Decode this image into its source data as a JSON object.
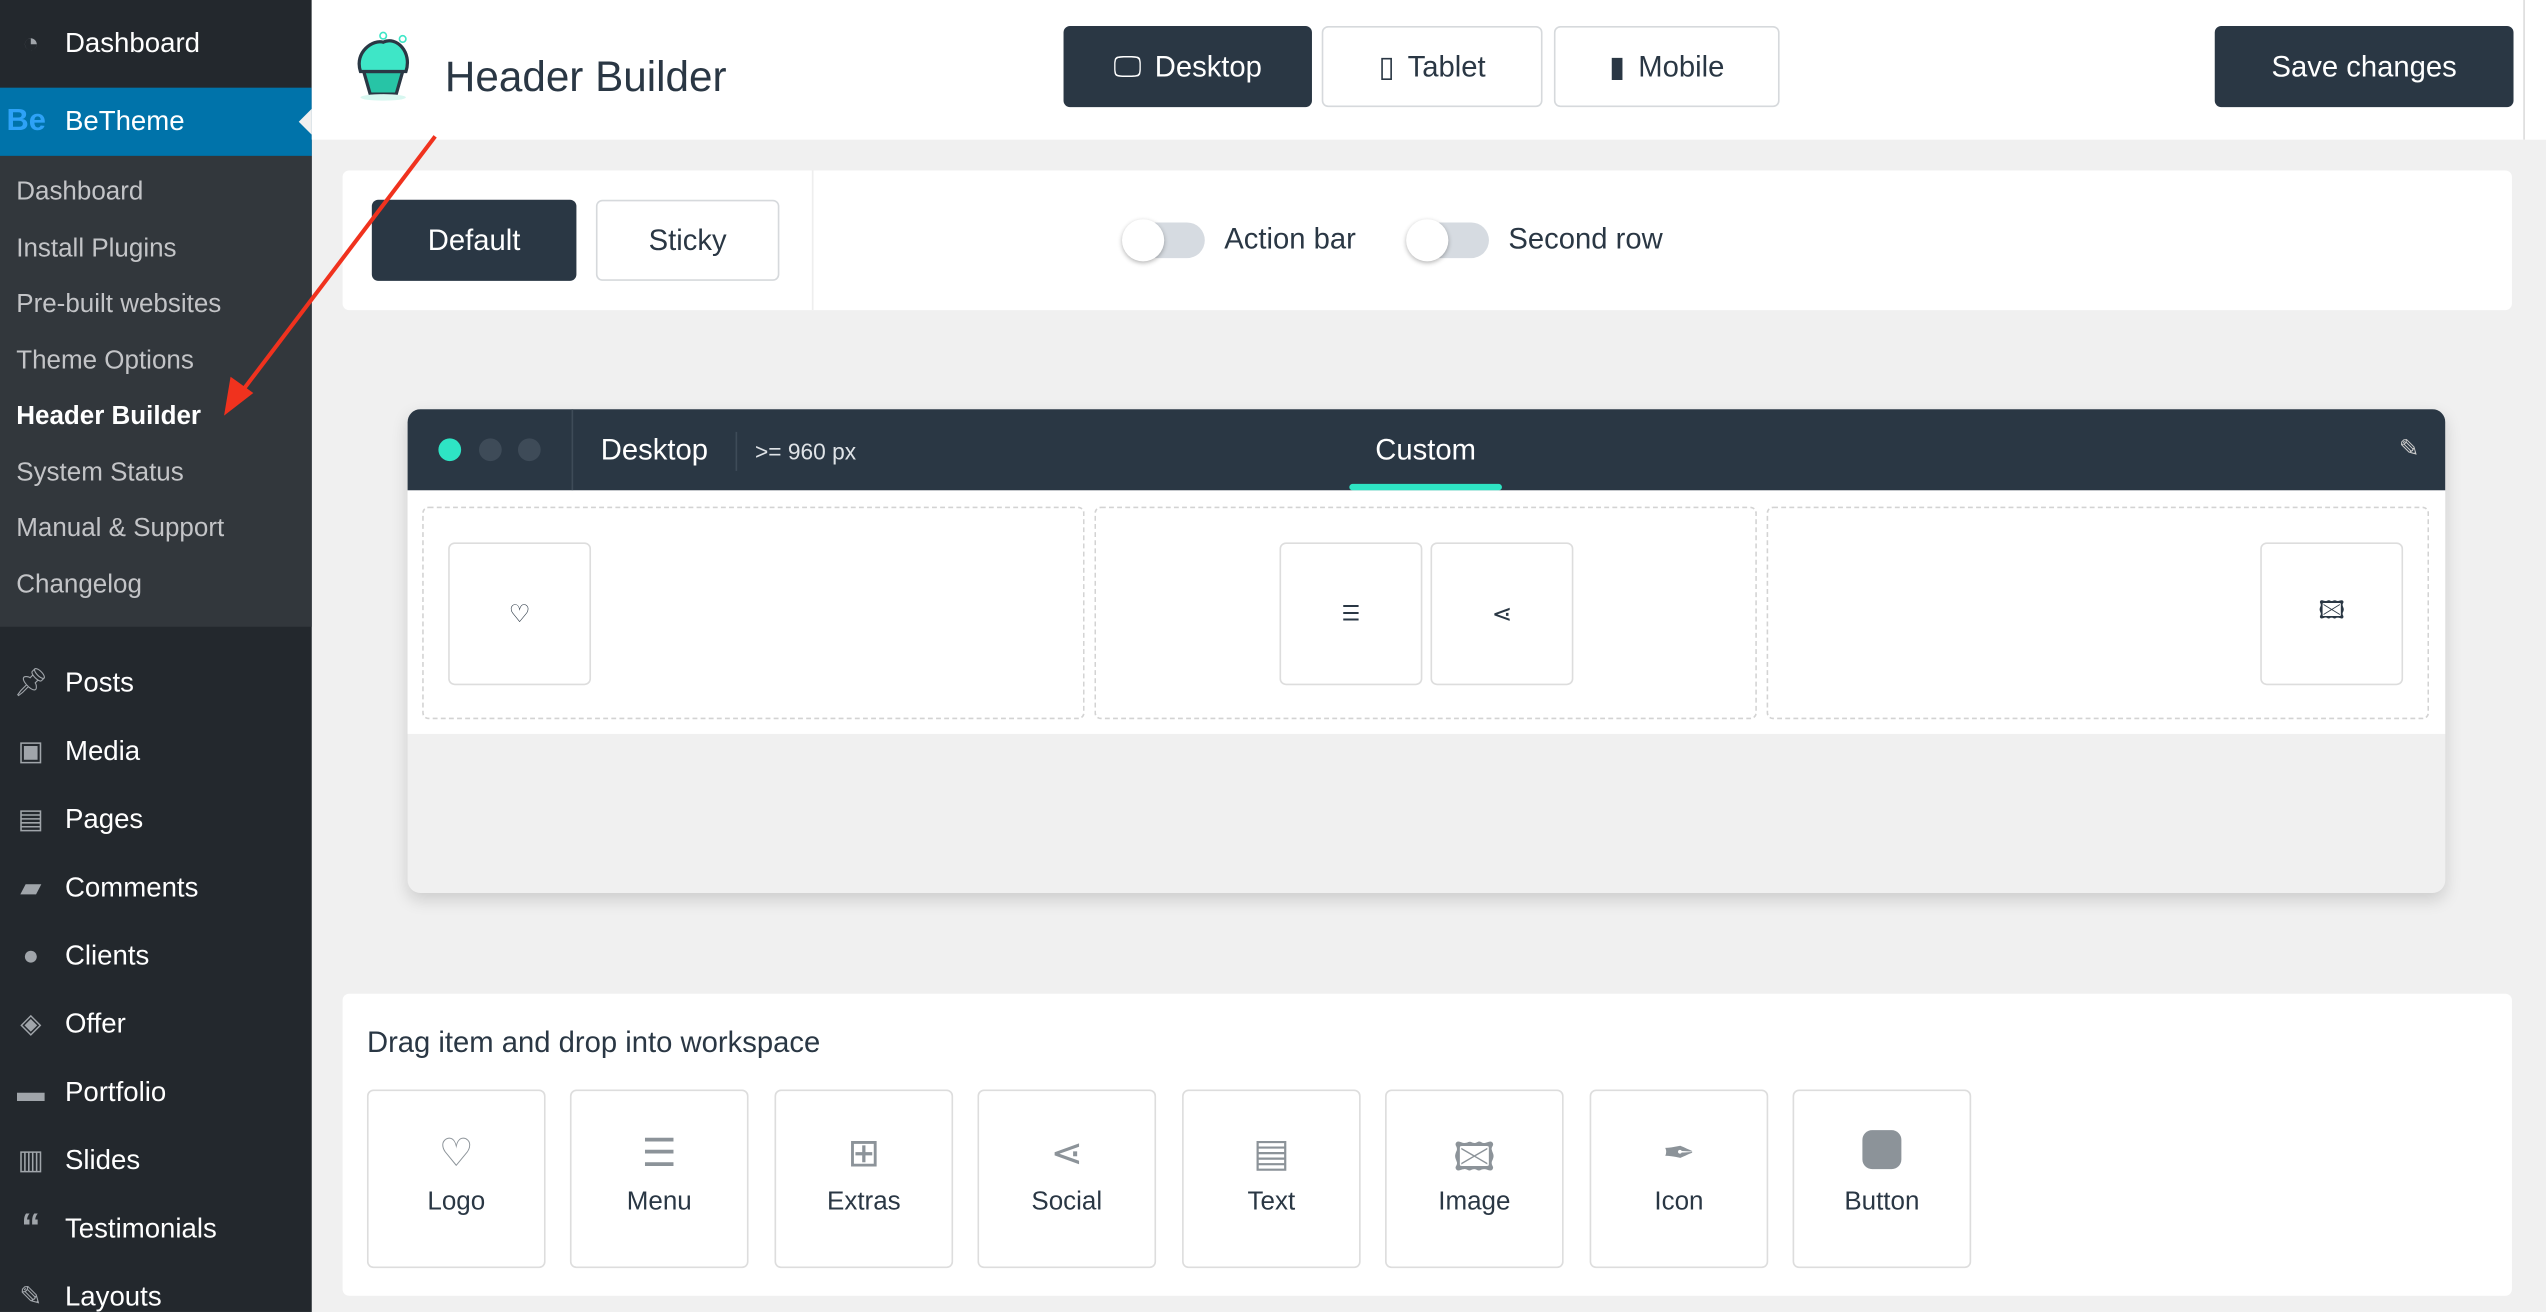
{
  "sidebar": {
    "dashboard": "Dashboard",
    "betheme": "BeTheme",
    "be_logo": "Be",
    "submenu": [
      "Dashboard",
      "Install Plugins",
      "Pre-built websites",
      "Theme Options",
      "Header Builder",
      "System Status",
      "Manual & Support",
      "Changelog"
    ],
    "active_submenu": "Header Builder",
    "menu": [
      {
        "label": "Posts",
        "icon": "pin-icon"
      },
      {
        "label": "Media",
        "icon": "media-icon"
      },
      {
        "label": "Pages",
        "icon": "pages-icon"
      },
      {
        "label": "Comments",
        "icon": "comment-icon"
      },
      {
        "label": "Clients",
        "icon": "user-icon"
      },
      {
        "label": "Offer",
        "icon": "tag-icon"
      },
      {
        "label": "Portfolio",
        "icon": "folder-icon"
      },
      {
        "label": "Slides",
        "icon": "slides-icon"
      },
      {
        "label": "Testimonials",
        "icon": "quote-icon"
      },
      {
        "label": "Layouts",
        "icon": "brush-icon"
      }
    ]
  },
  "header": {
    "title": "Header Builder",
    "devices": [
      "Desktop",
      "Tablet",
      "Mobile"
    ],
    "active_device": "Desktop",
    "save_label": "Save changes"
  },
  "modes": {
    "default": "Default",
    "sticky": "Sticky",
    "action_bar": "Action bar",
    "second_row": "Second row",
    "action_bar_on": false,
    "second_row_on": false
  },
  "workspace": {
    "device": "Desktop",
    "breakpoint": ">= 960 px",
    "tab": "Custom",
    "accent": "#2ee4c4"
  },
  "toolbox": {
    "title": "Drag item and drop into workspace",
    "items": [
      "Logo",
      "Menu",
      "Extras",
      "Social",
      "Text",
      "Image",
      "Icon",
      "Button"
    ]
  }
}
